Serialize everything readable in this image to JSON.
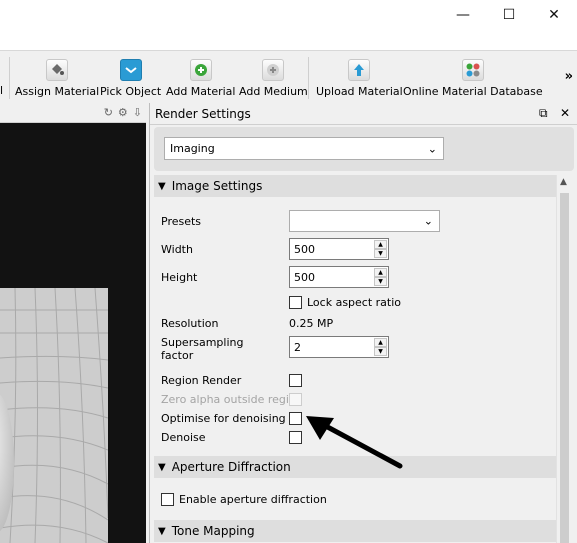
{
  "window": {
    "minimize_glyph": "—",
    "maximize_glyph": "☐",
    "close_glyph": "✕"
  },
  "toolbar": {
    "partial_label": "l",
    "items": [
      {
        "label": "Assign Material",
        "icon": "paint-bucket-icon"
      },
      {
        "label": "Pick Object",
        "icon": "pick-cube-icon"
      },
      {
        "label": "Add Material",
        "icon": "add-material-icon"
      },
      {
        "label": "Add Medium",
        "icon": "add-medium-icon"
      },
      {
        "label": "Upload Material",
        "icon": "upload-icon"
      },
      {
        "label": "Online Material Database",
        "icon": "material-database-icon"
      }
    ],
    "overflow_glyph": "»"
  },
  "render_settings": {
    "title": "Render Settings",
    "mode_combo": "Imaging",
    "sections": {
      "image_settings": "Image Settings",
      "aperture_diffraction": "Aperture Diffraction",
      "tone_mapping": "Tone Mapping"
    },
    "fields": {
      "presets_label": "Presets",
      "presets_value": "",
      "width_label": "Width",
      "width_value": "500",
      "height_label": "Height",
      "height_value": "500",
      "lock_aspect_label": "Lock aspect ratio",
      "resolution_label": "Resolution",
      "resolution_value": "0.25 MP",
      "supersampling_label_1": "Supersampling",
      "supersampling_label_2": "factor",
      "supersampling_value": "2",
      "region_render_label": "Region Render",
      "zero_alpha_label": "Zero alpha outside region",
      "optimise_label": "Optimise for denoising",
      "denoise_label": "Denoise",
      "enable_aperture_label": "Enable aperture diffraction"
    },
    "checkboxes": {
      "lock_aspect": false,
      "region_render": false,
      "zero_alpha": false,
      "optimise": false,
      "denoise": false,
      "enable_aperture": false
    }
  },
  "colors": {
    "viewport_bg": "#121212",
    "section_header": "#dedede",
    "upload_icon": "#2a9bd4",
    "add_icon": "#3aa53a",
    "pick_icon": "#2a9bd4"
  }
}
